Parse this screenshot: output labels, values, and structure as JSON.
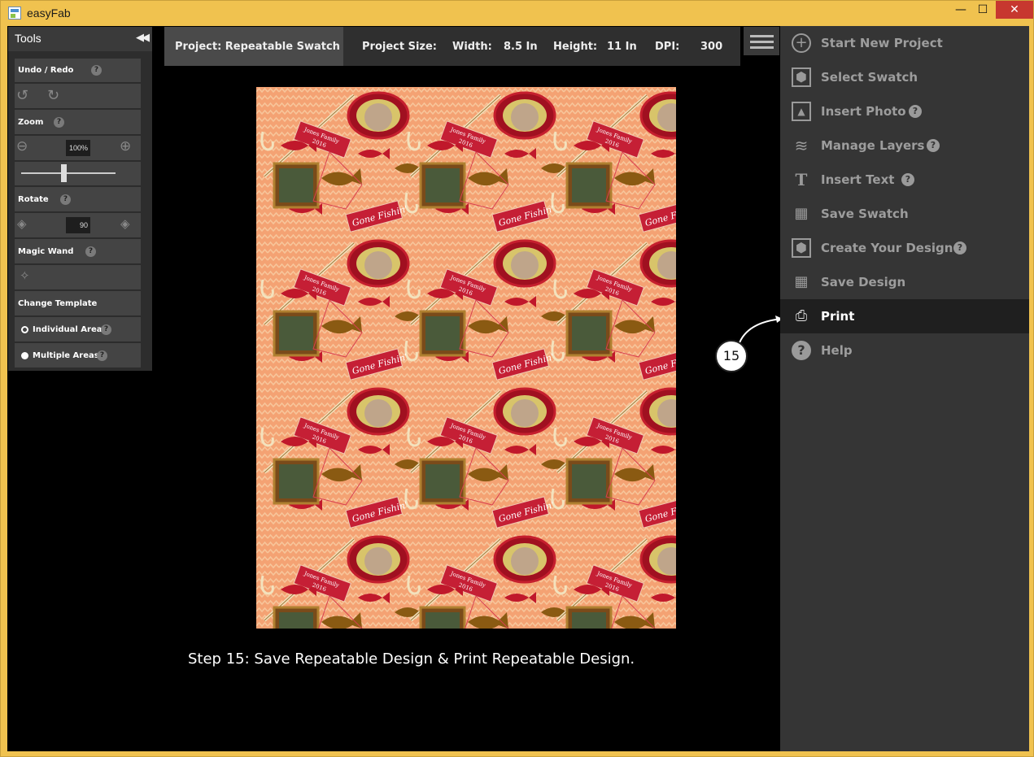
{
  "window": {
    "title": "easyFab",
    "controls": {
      "minimize": "—",
      "maximize": "☐",
      "close": "✕"
    }
  },
  "tools": {
    "title": "Tools",
    "collapse_icon": "double-chevron-left-icon",
    "undo_redo_label": "Undo / Redo",
    "zoom_label": "Zoom",
    "zoom_value": "100%",
    "zoom_slider_fraction": 0.5,
    "rotate_label": "Rotate",
    "rotate_value": "90",
    "magic_wand_label": "Magic Wand",
    "change_template_label": "Change Template",
    "template_options": [
      {
        "label": "Individual Area",
        "selected": false
      },
      {
        "label": "Multiple Areas",
        "selected": true
      }
    ],
    "help_glyph": "?"
  },
  "project_bar": {
    "project_name": "Project: Repeatable Swatch",
    "size_label": "Project Size:",
    "width_label": "Width:",
    "width_value": "8.5 In",
    "height_label": "Height:",
    "height_value": "11 In",
    "dpi_label": "DPI:",
    "dpi_value": "300"
  },
  "canvas": {
    "pattern_texts": {
      "tag": "Jones Family",
      "year": "2016",
      "banner": "Gone Fishin'"
    },
    "colors": {
      "background": "#f4a273",
      "zigzag": "#f7c59a",
      "red": "#c0182b",
      "olive": "#8a5a12",
      "cream": "#f8e8c8"
    }
  },
  "caption": "Step 15:  Save Repeatable Design & Print Repeatable Design.",
  "callout": {
    "number": "15"
  },
  "menu": {
    "items": [
      {
        "label": "Start New Project",
        "icon": "plus-circle-icon",
        "help": false,
        "active": false
      },
      {
        "label": "Select Swatch",
        "icon": "hexagon-icon",
        "help": false,
        "active": false
      },
      {
        "label": "Insert Photo",
        "icon": "image-icon",
        "help": true,
        "active": false
      },
      {
        "label": "Manage Layers",
        "icon": "layers-icon",
        "help": true,
        "active": false
      },
      {
        "label": "Insert Text",
        "icon": "text-cursor-icon",
        "help": true,
        "active": false
      },
      {
        "label": "Save Swatch",
        "icon": "grid-save-icon",
        "help": false,
        "active": false
      },
      {
        "label": "Create Your Design",
        "icon": "hexagon-icon",
        "help": true,
        "active": false
      },
      {
        "label": "Save Design",
        "icon": "grid-save-icon",
        "help": false,
        "active": false
      },
      {
        "label": "Print",
        "icon": "printer-icon",
        "help": false,
        "active": true
      },
      {
        "label": "Help",
        "icon": "question-circle-icon",
        "help": false,
        "active": false
      }
    ]
  }
}
